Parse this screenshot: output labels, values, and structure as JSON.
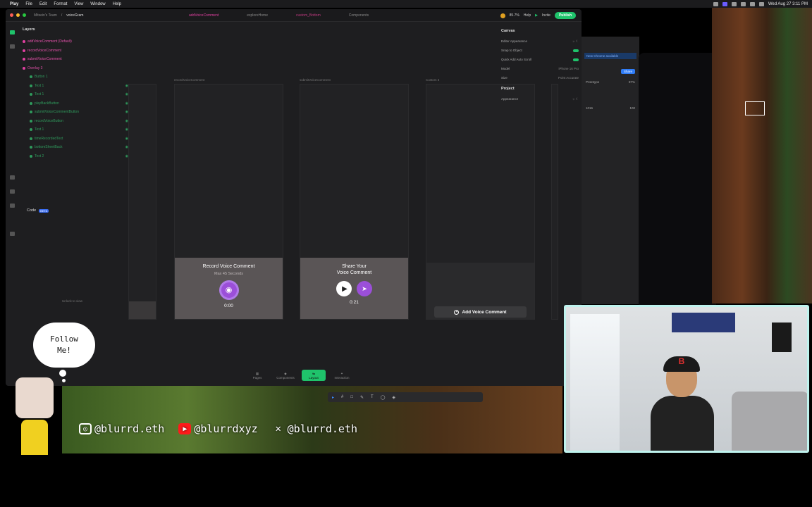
{
  "menubar": {
    "items": [
      "Play",
      "File",
      "Edit",
      "Format",
      "View",
      "Window",
      "Help"
    ],
    "clock": "Wed Aug 27  3:11 PM"
  },
  "titlebar": {
    "team": "Mitsein's Team",
    "project": "voiceGram",
    "tabs": [
      "addVoiceComment",
      "exploreHome",
      "custom_Bottom",
      "Components"
    ],
    "zoom": "85.7%",
    "help": "Help",
    "invite": "Invite",
    "publish": "Publish"
  },
  "layers": {
    "title": "Layers",
    "items": [
      {
        "label": "addVoiceComment (Default)",
        "color": "pink"
      },
      {
        "label": "recordVoiceComment",
        "color": "pink"
      },
      {
        "label": "submitVoiceComment",
        "color": "pink"
      },
      {
        "label": "Overlay 3",
        "color": "pink"
      },
      {
        "label": "Button 1",
        "color": "green"
      },
      {
        "label": "Text 1",
        "color": "green"
      },
      {
        "label": "Text 1",
        "color": "green"
      },
      {
        "label": "playBackButton",
        "color": "green"
      },
      {
        "label": "submitVoiceCommentButton",
        "color": "green"
      },
      {
        "label": "recordVoiceButton",
        "color": "green"
      },
      {
        "label": "Text 1",
        "color": "green"
      },
      {
        "label": "timeRecordedText",
        "color": "green"
      },
      {
        "label": "bottomSheetBack",
        "color": "green"
      },
      {
        "label": "Text 2",
        "color": "green"
      }
    ],
    "code_label": "Code",
    "beta": "BETA",
    "unlock": "Unlock to view"
  },
  "canvas": {
    "frames": [
      {
        "label": "recordVoiceComment",
        "title": "Record Voice Comment",
        "subtitle": "Max 45 Seconds",
        "timer": "0:00"
      },
      {
        "label": "submitVoiceComment",
        "title_line1": "Share Your",
        "title_line2": "Voice Comment",
        "timer": "0:21"
      },
      {
        "label": "Custom 3",
        "button": "Add Voice Comment"
      }
    ]
  },
  "inspector": {
    "canvas_title": "Canvas",
    "rows": [
      "Editor Appearance",
      "Snap to Object",
      "Quick Add Auto Scroll"
    ],
    "model_label": "Model",
    "model_value": "iPhone 16 Pro",
    "size_label": "Size",
    "size_value": "Point Accurate",
    "project_title": "Project",
    "appearance": "Appearance"
  },
  "bottom_tabs": [
    "Pages",
    "Components",
    "Layout",
    "Interaction"
  ],
  "side_window": {
    "banner": "New Chrome available",
    "share": "Share",
    "prototype": "Prototype",
    "proto_value": "87%",
    "row_value_a": "1016",
    "row_value_b": "100"
  },
  "overlay": {
    "follow_line1": "Follow",
    "follow_line2": "Me!",
    "instagram": "@blurrd.eth",
    "youtube": "@blurrdxyz",
    "x": "@blurrd.eth"
  },
  "colors": {
    "accent_pink": "#e040a0",
    "publish_green": "#1fc36b",
    "mic_purple": "#9b4fd9",
    "webcam_border": "#bff3ee"
  }
}
